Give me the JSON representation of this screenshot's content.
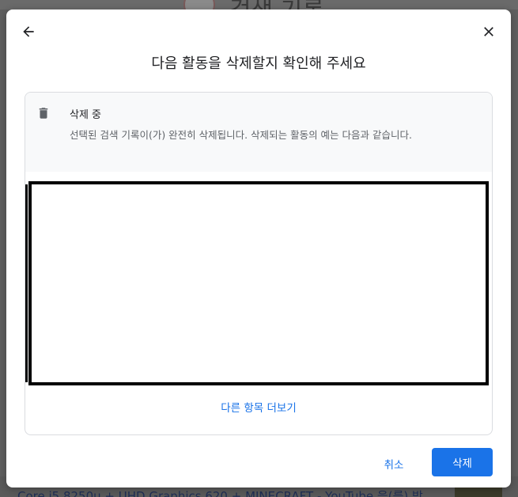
{
  "backdrop": {
    "title": "검색 기록",
    "footer_text": "Core i5 8250u + UHD Graphics 620 + MINECRAFT - YouTube 을(를) 방"
  },
  "dialog": {
    "title": "다음 활동을 삭제할지 확인해 주세요",
    "card": {
      "heading": "삭제 중",
      "description": "선택된 검색 기록이(가) 완전히 삭제됩니다. 삭제되는 활동의 예는 다음과 같습니다.",
      "more_link": "다른 항목 더보기"
    },
    "buttons": {
      "cancel": "취소",
      "delete": "삭제"
    }
  },
  "colors": {
    "accent": "#1a73e8",
    "card_header_bg": "#f8f9fa",
    "text_primary": "#202124",
    "text_secondary": "#5f6368"
  },
  "icons": {
    "back": "arrow-left-icon",
    "close": "close-icon",
    "trash": "trash-icon"
  }
}
